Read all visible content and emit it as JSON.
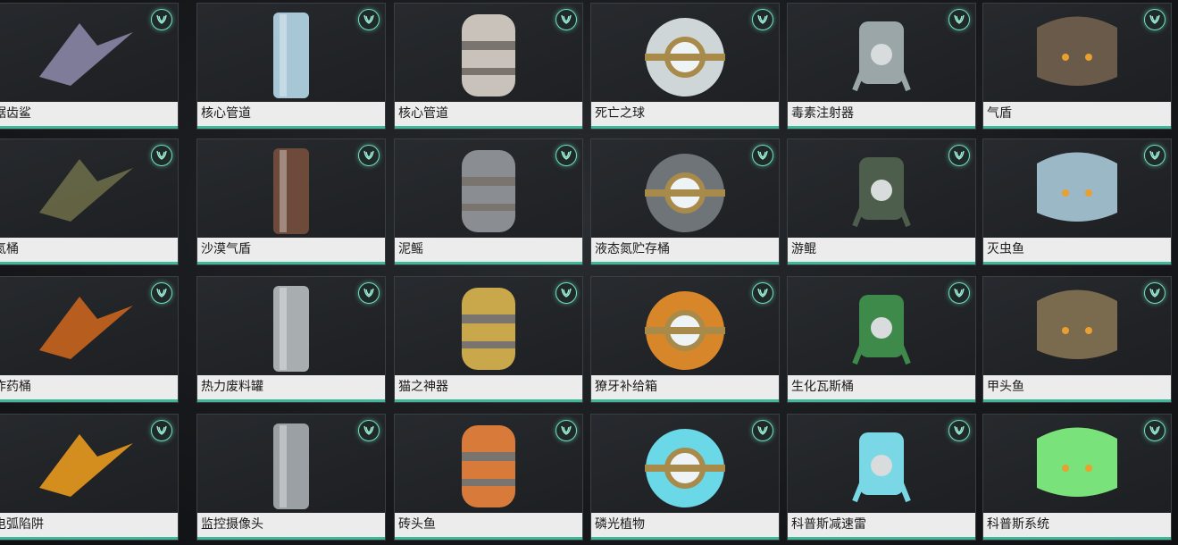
{
  "items": [
    {
      "label": "锯齿鲨",
      "icon": "sawshark-icon",
      "color": "#8a86a6"
    },
    {
      "label": "核心管道",
      "icon": "core-pipe-icon",
      "color": "#a7c6d6"
    },
    {
      "label": "核心管道",
      "icon": "core-pipe-segment-icon",
      "color": "#c9c2ba"
    },
    {
      "label": "死亡之球",
      "icon": "death-orb-icon",
      "color": "#cfd6d8"
    },
    {
      "label": "毒素注射器",
      "icon": "toxin-injector-icon",
      "color": "#9aa6a8"
    },
    {
      "label": "气盾",
      "icon": "gas-shield-icon",
      "color": "#6a5a4a"
    },
    {
      "label": "氮桶",
      "icon": "nitrogen-barrel-icon",
      "color": "#6a6a48"
    },
    {
      "label": "沙漠气盾",
      "icon": "desert-gas-shield-icon",
      "color": "#6e4a3a"
    },
    {
      "label": "泥鳐",
      "icon": "mud-ray-icon",
      "color": "#8a8e92"
    },
    {
      "label": "液态氮贮存桶",
      "icon": "liquid-nitrogen-tank-icon",
      "color": "#6e7478"
    },
    {
      "label": "游鲲",
      "icon": "swimming-fish-icon",
      "color": "#4e5e4c"
    },
    {
      "label": "灭虫鱼",
      "icon": "exterminator-fish-icon",
      "color": "#9ab8c6"
    },
    {
      "label": "炸药桶",
      "icon": "explosive-barrel-icon",
      "color": "#c8641e"
    },
    {
      "label": "热力废料罐",
      "icon": "thermal-waste-tank-icon",
      "color": "#a8adb0"
    },
    {
      "label": "猫之神器",
      "icon": "cat-artifact-icon",
      "color": "#c8a84a"
    },
    {
      "label": "獠牙补给箱",
      "icon": "fang-supply-crate-icon",
      "color": "#d8862a"
    },
    {
      "label": "生化瓦斯桶",
      "icon": "biogas-barrel-icon",
      "color": "#3e8a4a"
    },
    {
      "label": "甲头鱼",
      "icon": "armorhead-fish-icon",
      "color": "#7a6a4e"
    },
    {
      "label": "电弧陷阱",
      "icon": "arc-trap-icon",
      "color": "#e89a1e"
    },
    {
      "label": "监控摄像头",
      "icon": "security-camera-icon",
      "color": "#9aa0a4"
    },
    {
      "label": "砖头鱼",
      "icon": "brick-fish-icon",
      "color": "#d87a3a"
    },
    {
      "label": "磷光植物",
      "icon": "phosphor-plant-icon",
      "color": "#6ad8e6"
    },
    {
      "label": "科普斯减速雷",
      "icon": "corpus-slow-mine-icon",
      "color": "#7ad8e6"
    },
    {
      "label": "科普斯系统",
      "icon": "corpus-system-icon",
      "color": "#7ae27a"
    }
  ],
  "badge_icon": "faction-emblem-icon",
  "accent_color": "#3fb89a"
}
